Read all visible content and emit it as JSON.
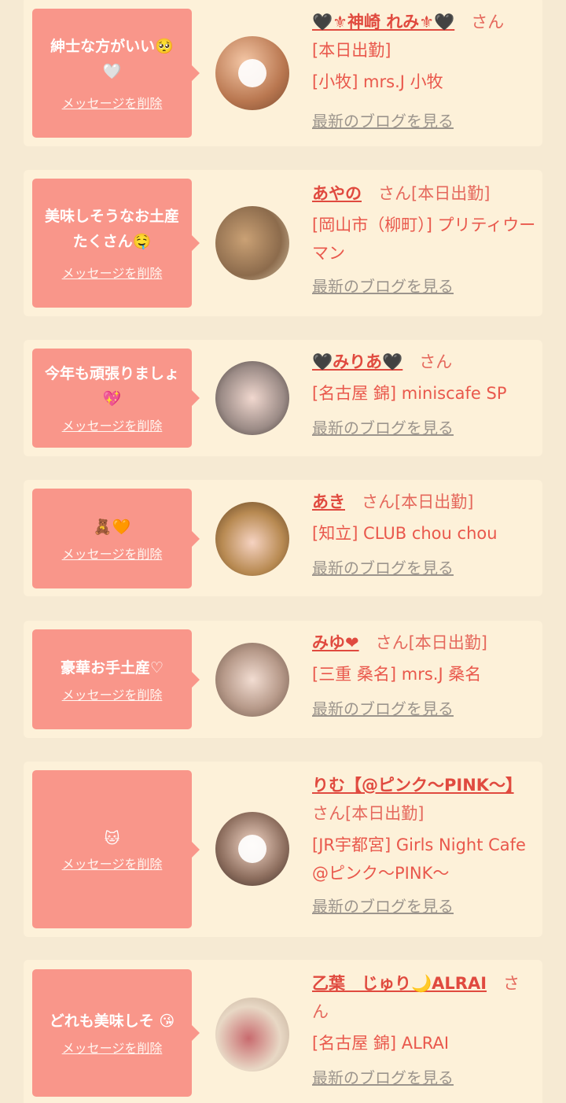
{
  "delete_label": "メッセージを削除",
  "blog_label": "最新のブログを見る",
  "san_label": "さん",
  "cards": [
    {
      "message": "紳士な方がいい🥺🤍",
      "name": "🖤⚜神崎 れみ⚜🖤",
      "suffix": "さん",
      "lines": [
        "[本日出勤]",
        "[小牧] mrs.J 小牧"
      ],
      "avatar_icon": "avatar-face-heart-icon"
    },
    {
      "message": "美味しそうなお土産たくさん🤤",
      "name": "あやの",
      "suffix": "さん[本日出勤]",
      "lines": [
        "[岡山市（柳町）] プリティウーマン"
      ],
      "avatar_icon": "avatar-photo"
    },
    {
      "message": "今年も頑張りましょ 💖",
      "name": "🖤みりあ🖤",
      "suffix": "さん",
      "lines": [
        "[名古屋 錦] miniscafe SP"
      ],
      "avatar_icon": "avatar-photo"
    },
    {
      "message": "🧸🧡",
      "name": "あき",
      "suffix": "さん[本日出勤]",
      "lines": [
        "[知立] CLUB chou chou"
      ],
      "avatar_icon": "avatar-photo"
    },
    {
      "message": "豪華お手土産♡",
      "name": "みゆ❤",
      "suffix": "さん[本日出勤]",
      "lines": [
        "[三重 桑名] mrs.J 桑名"
      ],
      "avatar_icon": "avatar-photo"
    },
    {
      "message": "🐱",
      "name": "りむ【@ピンク～PINK～】",
      "suffix": "さん[本日出勤]",
      "lines": [
        "[JR宇都宮] Girls Night Cafe @ピンク～PINK～"
      ],
      "avatar_icon": "avatar-face-heart-icon"
    },
    {
      "message": "どれも美味しそ 😘",
      "name": "乙葉　じゅり🌙ALRAI",
      "suffix": "さん",
      "lines": [
        "[名古屋 錦] ALRAI"
      ],
      "avatar_icon": "avatar-photo"
    }
  ]
}
